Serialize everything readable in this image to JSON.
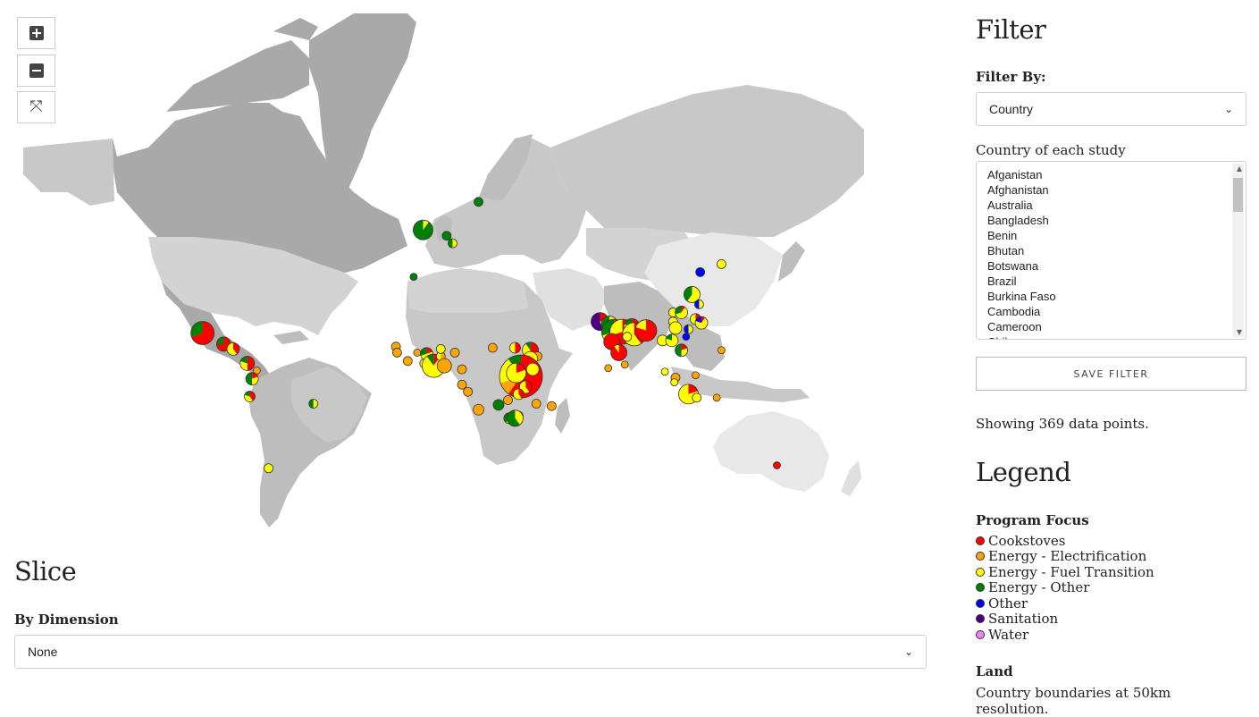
{
  "map": {
    "zoom_in_icon": "plus-square-icon",
    "zoom_out_icon": "minus-square-icon",
    "fullscreen_icon": "fullscreen-icon",
    "colors": {
      "Cookstoves": "#ff0000",
      "Energy - Electrification": "#ffa500",
      "Energy - Fuel Transition": "#ffff00",
      "Energy - Other": "#008000",
      "Other": "#0000ff",
      "Sanitation": "#4b0082",
      "Water": "#ee82ee"
    },
    "markers": [
      {
        "lat": 19.5,
        "lon": -99,
        "r": 13,
        "shares": {
          "Cookstoves": 0.7,
          "Energy - Other": 0.3
        }
      },
      {
        "lat": 15,
        "lon": -90,
        "r": 8,
        "shares": {
          "Cookstoves": 0.75,
          "Energy - Other": 0.25
        }
      },
      {
        "lat": 13,
        "lon": -86,
        "r": 7,
        "shares": {
          "Energy - Fuel Transition": 0.6,
          "Cookstoves": 0.4
        }
      },
      {
        "lat": 7,
        "lon": -80,
        "r": 8,
        "shares": {
          "Cookstoves": 0.5,
          "Energy - Fuel Transition": 0.3,
          "Energy - Other": 0.2
        }
      },
      {
        "lat": 4,
        "lon": -76,
        "r": 4,
        "shares": {
          "Energy - Electrification": 1
        }
      },
      {
        "lat": 0.5,
        "lon": -78,
        "r": 7,
        "shares": {
          "Energy - Other": 0.5,
          "Energy - Fuel Transition": 0.3,
          "Cookstoves": 0.2
        }
      },
      {
        "lat": -7,
        "lon": -79,
        "r": 6,
        "shares": {
          "Cookstoves": 0.4,
          "Energy - Fuel Transition": 0.4,
          "Energy - Other": 0.2
        }
      },
      {
        "lat": -10,
        "lon": -52,
        "r": 5,
        "shares": {
          "Energy - Other": 0.5,
          "Energy - Fuel Transition": 0.5
        }
      },
      {
        "lat": -35,
        "lon": -71,
        "r": 5,
        "shares": {
          "Energy - Fuel Transition": 1
        }
      },
      {
        "lat": 53.5,
        "lon": -5.5,
        "r": 11,
        "shares": {
          "Energy - Other": 0.9,
          "Energy - Fuel Transition": 0.1
        }
      },
      {
        "lat": 52,
        "lon": 4.5,
        "r": 5,
        "shares": {
          "Energy - Other": 1
        }
      },
      {
        "lat": 50,
        "lon": 7,
        "r": 5,
        "shares": {
          "Energy - Fuel Transition": 0.5,
          "Energy - Other": 0.5
        }
      },
      {
        "lat": 60,
        "lon": 18,
        "r": 5,
        "shares": {
          "Energy - Other": 1
        }
      },
      {
        "lat": 40,
        "lon": -9.5,
        "r": 4,
        "shares": {
          "Energy - Other": 1
        }
      },
      {
        "lat": 14,
        "lon": -17,
        "r": 5,
        "shares": {
          "Energy - Electrification": 1
        }
      },
      {
        "lat": 11.5,
        "lon": -16.5,
        "r": 5,
        "shares": {
          "Energy - Electrification": 1
        }
      },
      {
        "lat": 8,
        "lon": -12,
        "r": 5,
        "shares": {
          "Energy - Electrification": 1
        }
      },
      {
        "lat": 11.5,
        "lon": -8,
        "r": 4,
        "shares": {
          "Energy - Electrification": 1
        }
      },
      {
        "lat": 11,
        "lon": -4,
        "r": 7,
        "shares": {
          "Energy - Fuel Transition": 0.5,
          "Energy - Other": 0.3,
          "Cookstoves": 0.2
        }
      },
      {
        "lat": 7,
        "lon": -5,
        "r": 5,
        "shares": {
          "Energy - Fuel Transition": 1
        }
      },
      {
        "lat": 6,
        "lon": -1,
        "r": 13,
        "shares": {
          "Energy - Fuel Transition": 0.8,
          "Energy - Other": 0.1,
          "Cookstoves": 0.1
        }
      },
      {
        "lat": 10,
        "lon": 2,
        "r": 5,
        "shares": {
          "Energy - Fuel Transition": 0.5,
          "Energy - Electrification": 0.5
        }
      },
      {
        "lat": 13,
        "lon": 2,
        "r": 5,
        "shares": {
          "Energy - Fuel Transition": 1
        }
      },
      {
        "lat": 6,
        "lon": 3.5,
        "r": 8,
        "shares": {
          "Energy - Electrification": 1
        }
      },
      {
        "lat": 11.5,
        "lon": 8,
        "r": 5,
        "shares": {
          "Energy - Electrification": 1
        }
      },
      {
        "lat": 4.5,
        "lon": 11,
        "r": 5,
        "shares": {
          "Energy - Electrification": 1
        }
      },
      {
        "lat": -2,
        "lon": 11,
        "r": 5,
        "shares": {
          "Energy - Electrification": 1
        }
      },
      {
        "lat": -5,
        "lon": 13.5,
        "r": 5,
        "shares": {
          "Energy - Electrification": 1
        }
      },
      {
        "lat": -12.5,
        "lon": 18,
        "r": 6,
        "shares": {
          "Energy - Electrification": 1
        }
      },
      {
        "lat": 13.5,
        "lon": 24,
        "r": 5,
        "shares": {
          "Energy - Electrification": 1
        }
      },
      {
        "lat": 13.5,
        "lon": 33.5,
        "r": 6,
        "shares": {
          "Cookstoves": 0.5,
          "Energy - Fuel Transition": 0.5
        }
      },
      {
        "lat": 12.5,
        "lon": 40,
        "r": 9,
        "shares": {
          "Cookstoves": 0.6,
          "Energy - Fuel Transition": 0.3,
          "Energy - Other": 0.1
        }
      },
      {
        "lat": 10,
        "lon": 43,
        "r": 5,
        "shares": {
          "Energy - Electrification": 1
        }
      },
      {
        "lat": 9,
        "lon": 40,
        "r": 8,
        "shares": {
          "Energy - Fuel Transition": 1
        }
      },
      {
        "lat": 1.5,
        "lon": 36,
        "r": 24,
        "shares": {
          "Cookstoves": 0.6,
          "Energy - Fuel Transition": 0.2,
          "Energy - Other": 0.1,
          "Energy - Electrification": 0.1
        }
      },
      {
        "lat": 3,
        "lon": 34,
        "r": 11,
        "shares": {
          "Energy - Fuel Transition": 0.8,
          "Cookstoves": 0.2
        }
      },
      {
        "lat": 4.5,
        "lon": 41,
        "r": 7,
        "shares": {
          "Energy - Fuel Transition": 1
        }
      },
      {
        "lat": -3,
        "lon": 38,
        "r": 7,
        "shares": {
          "Energy - Fuel Transition": 0.6,
          "Cookstoves": 0.4
        }
      },
      {
        "lat": -6,
        "lon": 35,
        "r": 6,
        "shares": {
          "Energy - Fuel Transition": 0.6,
          "Cookstoves": 0.4
        }
      },
      {
        "lat": -8.5,
        "lon": 30.5,
        "r": 5,
        "shares": {
          "Energy - Electrification": 1
        }
      },
      {
        "lat": -10.5,
        "lon": 26.5,
        "r": 6,
        "shares": {
          "Energy - Other": 1
        }
      },
      {
        "lat": -10,
        "lon": 42.5,
        "r": 5,
        "shares": {
          "Energy - Electrification": 1
        }
      },
      {
        "lat": -11,
        "lon": 49,
        "r": 5,
        "shares": {
          "Energy - Electrification": 1
        }
      },
      {
        "lat": -15,
        "lon": 35,
        "r": 5,
        "shares": {
          "Energy - Electrification": 1
        }
      },
      {
        "lat": -16,
        "lon": 31,
        "r": 6,
        "shares": {
          "Energy - Fuel Transition": 0.6,
          "Energy - Other": 0.4
        }
      },
      {
        "lat": -16,
        "lon": 33.5,
        "r": 9,
        "shares": {
          "Energy - Other": 0.6,
          "Energy - Fuel Transition": 0.4
        }
      },
      {
        "lat": 24,
        "lon": 69.5,
        "r": 10,
        "shares": {
          "Sanitation": 0.55,
          "Energy - Fuel Transition": 0.25,
          "Cookstoves": 0.2
        }
      },
      {
        "lat": 23,
        "lon": 73.5,
        "r": 9,
        "shares": {
          "Energy - Fuel Transition": 0.6,
          "Energy - Other": 0.4
        }
      },
      {
        "lat": 20,
        "lon": 75.5,
        "r": 14,
        "shares": {
          "Energy - Fuel Transition": 0.5,
          "Energy - Other": 0.3,
          "Cookstoves": 0.2
        }
      },
      {
        "lat": 20,
        "lon": 79,
        "r": 14,
        "shares": {
          "Cookstoves": 0.7,
          "Energy - Fuel Transition": 0.3
        }
      },
      {
        "lat": 22,
        "lon": 83,
        "r": 9,
        "shares": {
          "Cookstoves": 0.5,
          "Energy - Fuel Transition": 0.3,
          "Energy - Other": 0.2
        }
      },
      {
        "lat": 19,
        "lon": 84,
        "r": 13,
        "shares": {
          "Energy - Fuel Transition": 0.6,
          "Cookstoves": 0.4
        }
      },
      {
        "lat": 20.5,
        "lon": 89,
        "r": 12,
        "shares": {
          "Cookstoves": 0.8,
          "Energy - Fuel Transition": 0.2
        }
      },
      {
        "lat": 18,
        "lon": 81,
        "r": 5,
        "shares": {
          "Energy - Fuel Transition": 1
        }
      },
      {
        "lat": 16,
        "lon": 74.5,
        "r": 9,
        "shares": {
          "Cookstoves": 1
        }
      },
      {
        "lat": 11.5,
        "lon": 77.5,
        "r": 9,
        "shares": {
          "Cookstoves": 0.9,
          "Energy - Fuel Transition": 0.1
        }
      },
      {
        "lat": 5,
        "lon": 73,
        "r": 4,
        "shares": {
          "Energy - Electrification": 1
        }
      },
      {
        "lat": 6.5,
        "lon": 80,
        "r": 4,
        "shares": {
          "Energy - Electrification": 1
        }
      },
      {
        "lat": 16.5,
        "lon": 96,
        "r": 6,
        "shares": {
          "Energy - Fuel Transition": 1
        }
      },
      {
        "lat": 16.5,
        "lon": 100,
        "r": 7,
        "shares": {
          "Energy - Fuel Transition": 0.8,
          "Energy - Other": 0.2
        }
      },
      {
        "lat": 12.5,
        "lon": 104,
        "r": 7,
        "shares": {
          "Energy - Other": 0.5,
          "Energy - Fuel Transition": 0.3,
          "Cookstoves": 0.2
        }
      },
      {
        "lat": 27.5,
        "lon": 100.5,
        "r": 5,
        "shares": {
          "Energy - Fuel Transition": 1
        }
      },
      {
        "lat": 24,
        "lon": 100.5,
        "r": 5,
        "shares": {
          "Energy - Fuel Transition": 1
        }
      },
      {
        "lat": 21.5,
        "lon": 101.5,
        "r": 7,
        "shares": {
          "Energy - Fuel Transition": 1
        }
      },
      {
        "lat": 34,
        "lon": 108.5,
        "r": 9,
        "shares": {
          "Energy - Fuel Transition": 0.6,
          "Energy - Other": 0.4
        }
      },
      {
        "lat": 27.5,
        "lon": 104,
        "r": 7,
        "shares": {
          "Energy - Fuel Transition": 0.6,
          "Energy - Other": 0.3,
          "Cookstoves": 0.1
        }
      },
      {
        "lat": 30.5,
        "lon": 111.5,
        "r": 5,
        "shares": {
          "Other": 0.5,
          "Energy - Fuel Transition": 0.5
        }
      },
      {
        "lat": 25,
        "lon": 110,
        "r": 6,
        "shares": {
          "Energy - Fuel Transition": 0.6,
          "Cookstoves": 0.4
        }
      },
      {
        "lat": 23.5,
        "lon": 112.5,
        "r": 7,
        "shares": {
          "Energy - Fuel Transition": 0.7,
          "Other": 0.2,
          "Cookstoves": 0.1
        }
      },
      {
        "lat": 21,
        "lon": 107,
        "r": 5,
        "shares": {
          "Other": 0.5,
          "Energy - Fuel Transition": 0.5
        }
      },
      {
        "lat": 18,
        "lon": 106,
        "r": 4,
        "shares": {
          "Other": 1
        }
      },
      {
        "lat": 41.5,
        "lon": 112,
        "r": 5,
        "shares": {
          "Other": 1
        }
      },
      {
        "lat": 44,
        "lon": 121,
        "r": 5,
        "shares": {
          "Energy - Fuel Transition": 1
        }
      },
      {
        "lat": 12.5,
        "lon": 121,
        "r": 4,
        "shares": {
          "Energy - Electrification": 1
        }
      },
      {
        "lat": 3.5,
        "lon": 97,
        "r": 4,
        "shares": {
          "Energy - Fuel Transition": 1
        }
      },
      {
        "lat": 1,
        "lon": 101.5,
        "r": 5,
        "shares": {
          "Energy - Electrification": 1
        }
      },
      {
        "lat": -1,
        "lon": 101,
        "r": 4,
        "shares": {
          "Energy - Fuel Transition": 1
        }
      },
      {
        "lat": 2,
        "lon": 110,
        "r": 4,
        "shares": {
          "Energy - Electrification": 1
        }
      },
      {
        "lat": -6,
        "lon": 107,
        "r": 11,
        "shares": {
          "Energy - Fuel Transition": 0.8,
          "Cookstoves": 0.2
        }
      },
      {
        "lat": -7.5,
        "lon": 110.5,
        "r": 5,
        "shares": {
          "Energy - Fuel Transition": 1
        }
      },
      {
        "lat": -7.5,
        "lon": 119,
        "r": 4,
        "shares": {
          "Energy - Electrification": 1
        }
      },
      {
        "lat": -34,
        "lon": 144.5,
        "r": 4,
        "shares": {
          "Cookstoves": 1
        }
      }
    ]
  },
  "slice": {
    "title": "Slice",
    "by_dimension_label": "By Dimension",
    "dimension_selected": "None"
  },
  "filter": {
    "title": "Filter",
    "filter_by_label": "Filter By:",
    "filter_by_selected": "Country",
    "country_label": "Country of each study",
    "countries": [
      "Afganistan",
      "Afghanistan",
      "Australia",
      "Bangladesh",
      "Benin",
      "Bhutan",
      "Botswana",
      "Brazil",
      "Burkina Faso",
      "Cambodia",
      "Cameroon",
      "Chile"
    ],
    "save_label": "SAVE FILTER",
    "showing_text": "Showing 369 data points."
  },
  "legend": {
    "title": "Legend",
    "program_focus_title": "Program Focus",
    "items": [
      {
        "label": "Cookstoves",
        "color": "#ff0000"
      },
      {
        "label": "Energy - Electrification",
        "color": "#ffa500"
      },
      {
        "label": "Energy - Fuel Transition",
        "color": "#ffff00"
      },
      {
        "label": "Energy - Other",
        "color": "#008000"
      },
      {
        "label": "Other",
        "color": "#0000ff"
      },
      {
        "label": "Sanitation",
        "color": "#4b0082"
      },
      {
        "label": "Water",
        "color": "#ee82ee"
      }
    ],
    "land_title": "Land",
    "land_text": "Country boundaries at 50km resolution."
  }
}
